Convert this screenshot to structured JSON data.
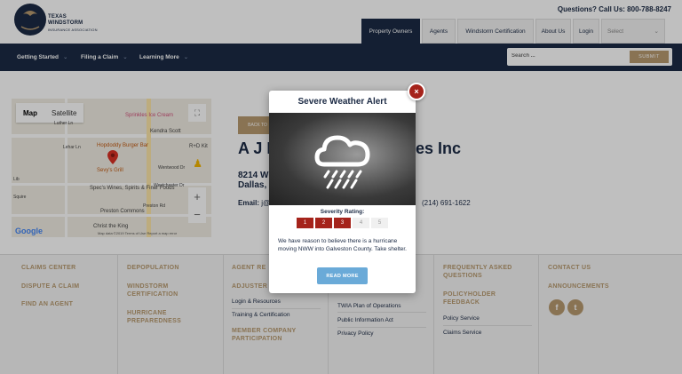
{
  "header": {
    "logo_title": "TEXAS WINDSTORM",
    "logo_sub": "INSURANCE ASSOCIATION",
    "logo_mark": "TWIA",
    "questions_label": "Questions? Call Us:",
    "questions_phone": "800-788-8247",
    "tabs": [
      "Property Owners",
      "Agents",
      "Windstorm Certification",
      "About Us",
      "Login"
    ],
    "select_placeholder": "Select"
  },
  "nav": {
    "items": [
      "Getting Started",
      "Filing a Claim",
      "Learning More"
    ],
    "search_placeholder": "Search ...",
    "search_button": "SUBMIT"
  },
  "map": {
    "type_map": "Map",
    "type_satellite": "Satellite",
    "labels": [
      "Sprinkles Ice Cream",
      "Kendra Scott",
      "Hopdoddy Burger Bar",
      "R+D Kit",
      "Sevy's Grill",
      "Spec's Wines, Spirits & Finer Foods",
      "Preston Commons",
      "Christ the King",
      "Lehar Ln",
      "Wentwood Dr",
      "Westchester Dr",
      "Preston Rd",
      "Squire",
      "Lib",
      "Luther Ln"
    ],
    "google": "Google",
    "footer": "Map data ©2019   Terms of Use   Report a map error"
  },
  "content": {
    "back_label": "BACK TO",
    "name_left": "A J I",
    "name_right": "es Inc",
    "address_line1": "8214 W",
    "address_line2": "Dallas, T",
    "email_label": "Email:",
    "email_value": "j@",
    "phone": "(214) 691-1622"
  },
  "footer": {
    "col1": [
      "CLAIMS CENTER",
      "DISPUTE A CLAIM",
      "FIND AN AGENT"
    ],
    "col2": [
      "DEPOPULATION",
      "WINDSTORM CERTIFICATION",
      "HURRICANE PREPAREDNESS"
    ],
    "col3_heads": [
      "AGENT RE",
      "ADJUSTER",
      "MEMBER COMPANY PARTICIPATION"
    ],
    "col3_links": [
      "Login & Resources",
      "Training & Certification"
    ],
    "col4_links": [
      "TWIA Plan of Operations",
      "Public Information Act",
      "Privacy Policy"
    ],
    "col5_heads": [
      "FREQUENTLY ASKED QUESTIONS",
      "POLICYHOLDER FEEDBACK"
    ],
    "col5_links": [
      "Policy Service",
      "Claims Service"
    ],
    "col6": [
      "CONTACT US",
      "ANNOUNCEMENTS"
    ],
    "social": [
      "f",
      "t"
    ]
  },
  "modal": {
    "title": "Severe Weather Alert",
    "close": "×",
    "severity_label": "Severity Rating:",
    "ratings": [
      "1",
      "2",
      "3",
      "4",
      "5"
    ],
    "severity_value": 3,
    "message": "We have reason to believe there is a hurricane moving NWW into Galveston County. Take shelter.",
    "button": "READ MORE"
  },
  "colors": {
    "navy": "#1b2a44",
    "gold": "#b79a6f",
    "alert_red": "#a5231b",
    "button_blue": "#6aaad8"
  }
}
